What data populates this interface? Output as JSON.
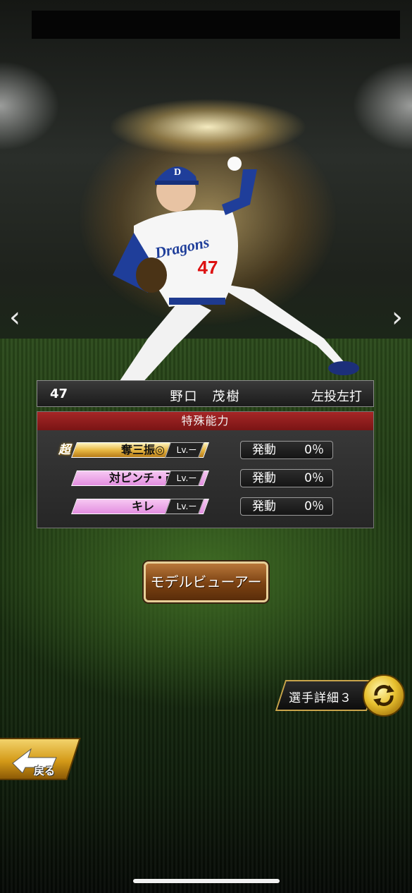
{
  "player": {
    "number": "47",
    "name": "野口　茂樹",
    "handedness": "左投左打",
    "jersey_number": "47",
    "team_logo": "Dragons",
    "cap_letter": "D"
  },
  "nav": {
    "prev_icon": "chevron-left-icon",
    "next_icon": "chevron-right-icon",
    "prev_glyph": "‹",
    "next_glyph": "›"
  },
  "abilities": {
    "header": "特殊能力",
    "items": [
      {
        "badge": "超",
        "label": "奪三振◎",
        "level": "Lv.ー",
        "activation_label": "発動",
        "activation_value": "0％",
        "color": "#e9b945"
      },
      {
        "badge": "",
        "label": "対ピンチ・改",
        "level": "Lv.ー",
        "activation_label": "発動",
        "activation_value": "0％",
        "color": "#e38ee0"
      },
      {
        "badge": "",
        "label": "キレ",
        "level": "Lv.ー",
        "activation_label": "発動",
        "activation_value": "0％",
        "color": "#e38ee0"
      }
    ]
  },
  "buttons": {
    "model_viewer": "モデルビューアー",
    "player_detail": "選手詳細３",
    "back": "戻る"
  },
  "colors": {
    "header_red": "#a62626",
    "gold": "#c9a44b"
  }
}
